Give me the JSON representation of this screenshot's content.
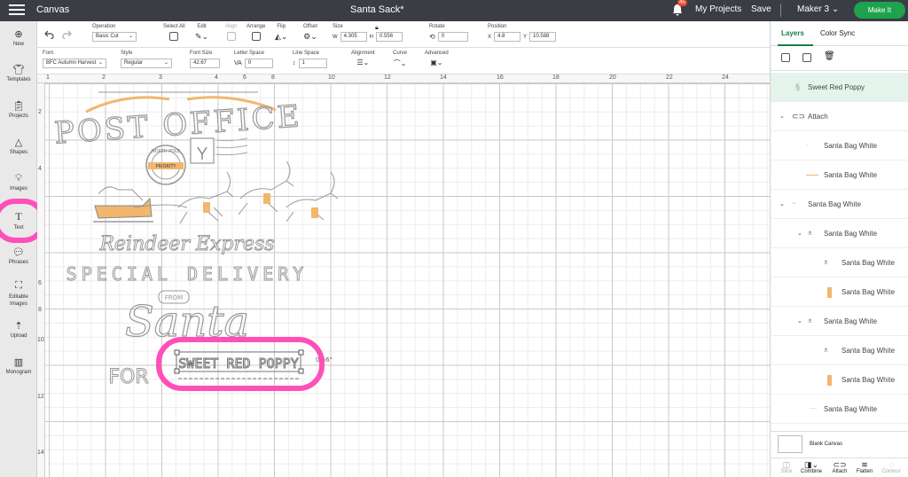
{
  "app": {
    "menu_label": "Canvas",
    "project_title": "Santa Sack*",
    "notifications_count": "45",
    "my_projects": "My Projects",
    "save": "Save",
    "machine": "Maker 3",
    "make_it": "Make It"
  },
  "toolbar": {
    "operation_label": "Operation",
    "operation_value": "Basic Cut",
    "select_all": "Select All",
    "edit": "Edit",
    "align": "Align",
    "arrange": "Arrange",
    "flip": "Flip",
    "offset": "Offset",
    "size_label": "Size",
    "w_label": "W",
    "w_value": "4.305",
    "h_label": "H",
    "h_value": "0.556",
    "rotate_label": "Rotate",
    "rotate_value": "0",
    "position_label": "Position",
    "x_label": "X",
    "x_value": "4.8",
    "y_label": "Y",
    "y_value": "10.588"
  },
  "text_toolbar": {
    "font_label": "Font",
    "font_value": "BFC Autumn Harvest",
    "style_label": "Style",
    "style_value": "Regular",
    "font_size_label": "Font Size",
    "font_size_value": "42.67",
    "letter_space_label": "Letter Space",
    "letter_space_value": "0",
    "line_space_label": "Line Space",
    "line_space_value": "1",
    "alignment_label": "Alignment",
    "curve_label": "Curve",
    "advanced_label": "Advanced"
  },
  "sidebar": {
    "items": [
      {
        "label": "New",
        "icon": "plus-circle-icon"
      },
      {
        "label": "Templates",
        "icon": "shirt-icon"
      },
      {
        "label": "Projects",
        "icon": "clipboard-icon"
      },
      {
        "label": "Shapes",
        "icon": "shapes-icon"
      },
      {
        "label": "Images",
        "icon": "lightbulb-icon"
      },
      {
        "label": "Text",
        "icon": "text-icon"
      },
      {
        "label": "Phrases",
        "icon": "speech-bubble-icon"
      },
      {
        "label": "Editable Images",
        "icon": "edit-image-icon"
      },
      {
        "label": "Upload",
        "icon": "upload-icon"
      },
      {
        "label": "Monogram",
        "icon": "monogram-icon"
      }
    ]
  },
  "rulers": {
    "top": [
      "1",
      "2",
      "3",
      "4",
      "6",
      "8",
      "10",
      "12",
      "14",
      "16",
      "18",
      "20",
      "22",
      "24"
    ],
    "left": [
      "2",
      "4",
      "6",
      "8",
      "10",
      "12",
      "14"
    ]
  },
  "design": {
    "post_office": "POST OFFICE",
    "north_pole": "NORTH POLE",
    "priority": "PRIORITY",
    "reindeer_express": "Reindeer Express",
    "special_delivery": "SPECIAL DELIVERY",
    "from": "FROM",
    "santa": "Santa",
    "for": "FOR",
    "sweet_red_poppy": "SWEET RED POPPY",
    "dimension_label": "0.56\""
  },
  "layers_panel": {
    "tab_layers": "Layers",
    "tab_color_sync": "Color Sync",
    "rows": [
      {
        "name": "Sweet Red Poppy"
      },
      {
        "name": "Attach"
      },
      {
        "name": "Santa Bag White"
      },
      {
        "name": "Santa Bag White"
      },
      {
        "name": "Santa Bag White"
      },
      {
        "name": "Santa Bag White"
      },
      {
        "name": "Santa Bag White"
      },
      {
        "name": "Santa Bag White"
      },
      {
        "name": "Santa Bag White"
      },
      {
        "name": "Santa Bag White"
      },
      {
        "name": "Santa Bag White"
      },
      {
        "name": "Santa Bag White"
      }
    ],
    "blank_canvas": "Blank Canvas",
    "bottom": {
      "slice": "Slice",
      "combine": "Combine",
      "attach": "Attach",
      "flatten": "Flatten",
      "contour": "Contour"
    }
  },
  "colors": {
    "topbar": "#3a3d44",
    "accent_green": "#1fa24d",
    "highlight_pink": "#ff4fb8",
    "gold": "#f2b66d"
  }
}
